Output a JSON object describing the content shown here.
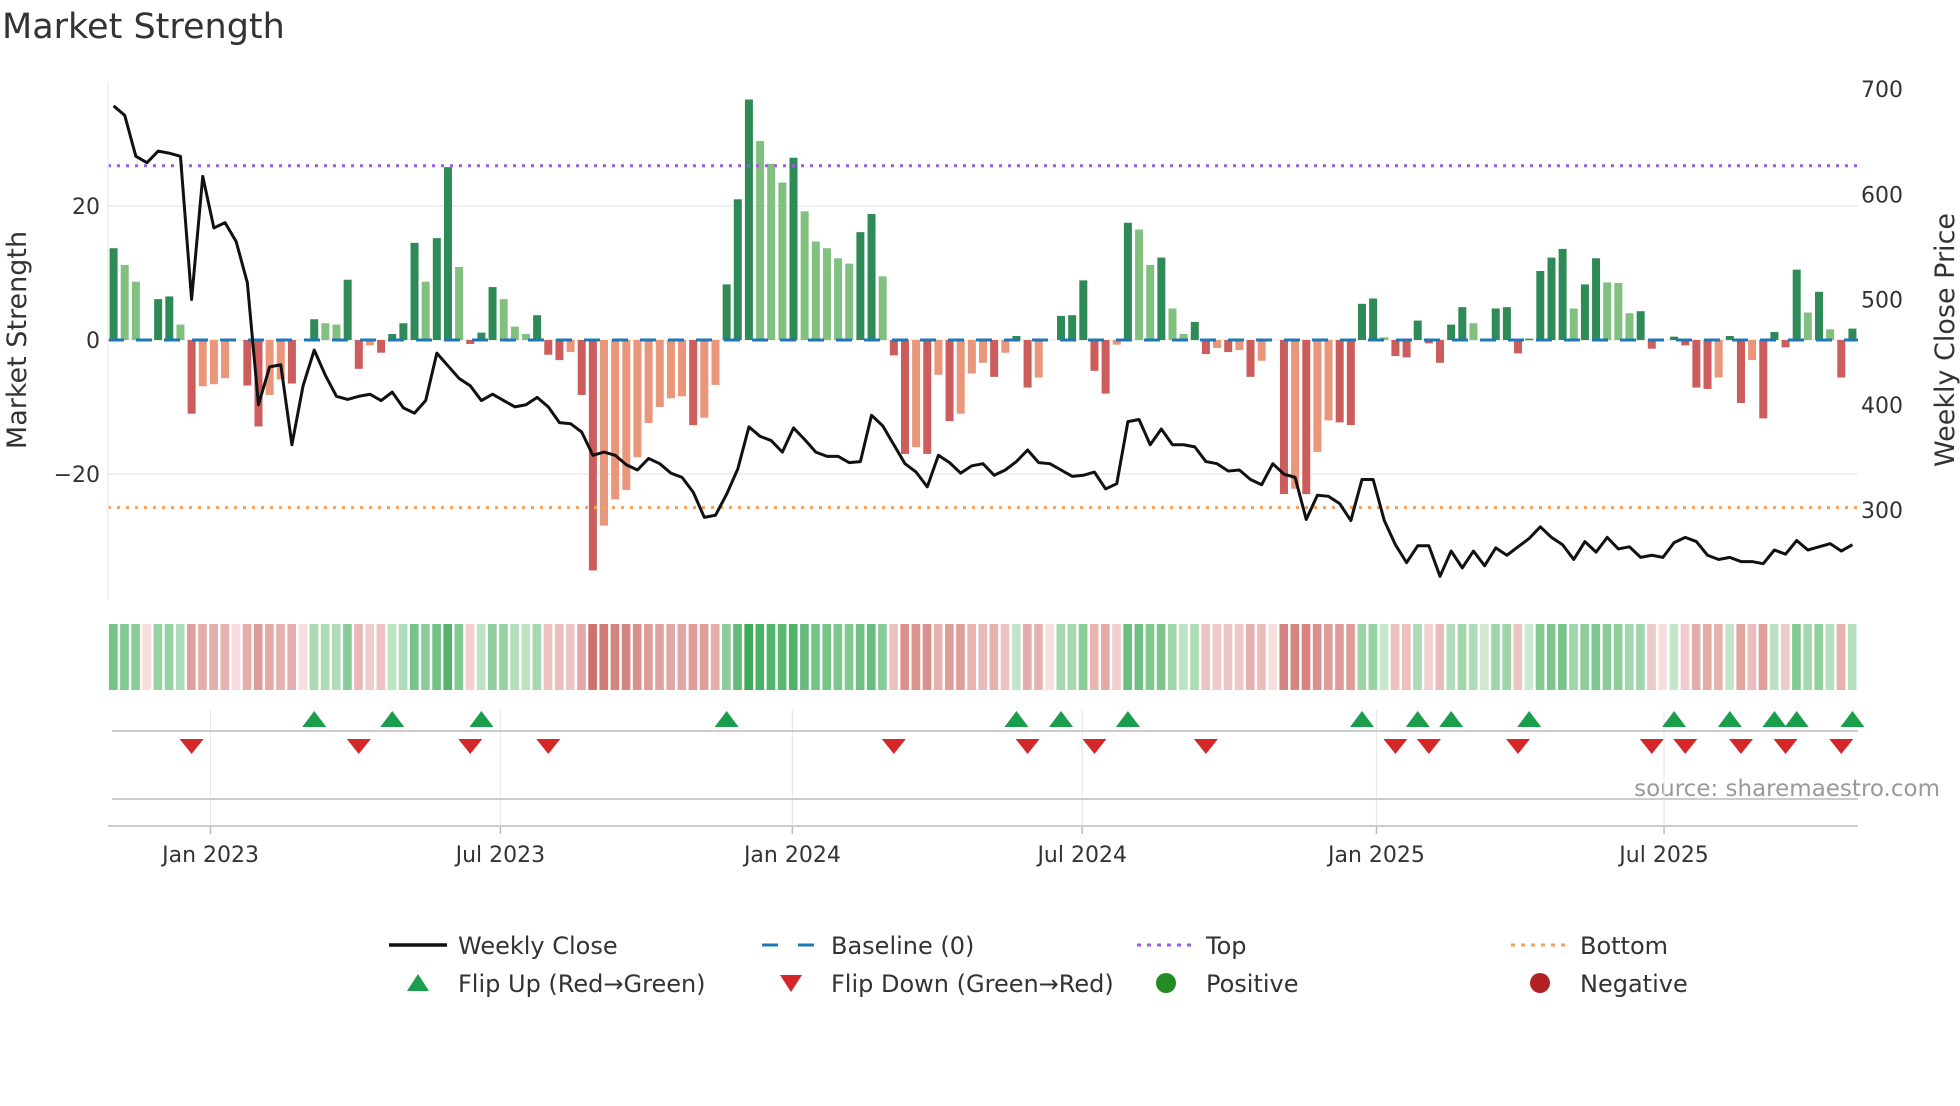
{
  "title": "Market Strength",
  "source": "source: sharemaestro.com",
  "colors": {
    "pos_dark": "#2e8b57",
    "pos_light": "#82c07f",
    "neg_dark": "#cd5c5c",
    "neg_light": "#e9967a",
    "baseline": "#1f77b4",
    "top": "#9b5de5",
    "bottom": "#f4a261",
    "close": "#111111",
    "flip_up": "#1a9e4b",
    "flip_down": "#d62728",
    "positive": "#228b22",
    "negative": "#b22222"
  },
  "chart_data": {
    "type": "bar",
    "title": "Market Strength",
    "ylabel": "Market Strength",
    "y2label": "Weekly Close Price",
    "ylim": [
      -38,
      38
    ],
    "y2lim": [
      190,
      700
    ],
    "yticks": [
      {
        "v": 20,
        "label": "20"
      },
      {
        "v": 0,
        "label": "0"
      },
      {
        "v": -20,
        "label": "−20"
      }
    ],
    "y2ticks": [
      {
        "v": 700,
        "label": "700"
      },
      {
        "v": 600,
        "label": "600"
      },
      {
        "v": 500,
        "label": "500"
      },
      {
        "v": 400,
        "label": "400"
      },
      {
        "v": 300,
        "label": "300"
      }
    ],
    "top_level": 26,
    "bottom_level": -25,
    "baseline": 0,
    "xticks": [
      {
        "week": 8.7,
        "label": "Jan 2023"
      },
      {
        "week": 34.7,
        "label": "Jul 2023"
      },
      {
        "week": 60.9,
        "label": "Jan 2024"
      },
      {
        "week": 86.9,
        "label": "Jul 2024"
      },
      {
        "week": 113.3,
        "label": "Jan 2025"
      },
      {
        "week": 139.1,
        "label": "Jul 2025"
      }
    ],
    "strength": [
      13.7,
      11.2,
      8.7,
      0,
      6.1,
      6.5,
      2.3,
      -11,
      -6.9,
      -6.6,
      -5.7,
      0,
      -6.8,
      -12.9,
      -8.2,
      -5.9,
      -6.5,
      0,
      3.1,
      2.5,
      2.3,
      9,
      -4.3,
      -0.8,
      -1.9,
      0.9,
      2.5,
      14.5,
      8.7,
      15.2,
      25.8,
      10.9,
      -0.6,
      1.1,
      7.9,
      6.1,
      2,
      0.9,
      3.7,
      -2.2,
      -3,
      -1.8,
      -8.2,
      -34.4,
      -27.7,
      -23.8,
      -22.4,
      -17.5,
      -12.4,
      -10,
      -8.7,
      -8.4,
      -12.7,
      -11.6,
      -6.7,
      8.3,
      21,
      35.9,
      29.7,
      26.3,
      23.5,
      27.2,
      19.2,
      14.7,
      13.7,
      12.2,
      11.4,
      16.1,
      18.8,
      9.5,
      -2.3,
      -17,
      -16,
      -17,
      -5.2,
      -12.1,
      -11,
      -5,
      -3.4,
      -5.5,
      -1.9,
      0.6,
      -7.1,
      -5.6,
      0,
      3.6,
      3.7,
      8.9,
      -4.6,
      -8,
      -0.7,
      17.5,
      16.5,
      11.2,
      12.3,
      4.7,
      0.9,
      2.7,
      -2.1,
      -1.2,
      -1.8,
      -1.5,
      -5.5,
      -3.1,
      0,
      -23,
      -22.2,
      -23,
      -16.7,
      -12,
      -12.3,
      -12.7,
      5.4,
      6.2,
      0.4,
      -2.4,
      -2.6,
      2.9,
      -0.5,
      -3.4,
      2.3,
      4.9,
      2.5,
      0.1,
      4.7,
      4.9,
      -2,
      0.2,
      10.3,
      12.3,
      13.6,
      4.7,
      8.3,
      12.2,
      8.6,
      8.5,
      4,
      4.3,
      -1.3,
      0,
      0.5,
      -0.8,
      -7.1,
      -7.3,
      -5.6,
      0.6,
      -9.4,
      -3,
      -11.7,
      1.2,
      -1.1,
      10.5,
      4.1,
      7.2,
      1.6,
      -5.6,
      1.7
    ],
    "weekly_close": [
      684,
      675,
      636,
      630,
      641,
      639,
      636,
      500,
      617,
      568,
      573,
      555,
      516,
      400,
      436,
      438,
      362,
      418,
      452,
      428,
      408,
      405,
      408,
      410,
      404,
      412,
      397,
      392,
      404,
      449,
      437,
      425,
      418,
      404,
      410,
      404,
      398,
      400,
      407,
      398,
      383,
      382,
      374,
      352,
      355,
      352,
      343,
      338,
      349,
      344,
      335,
      331,
      317,
      293,
      295,
      315,
      339,
      379,
      370,
      366,
      355,
      378,
      367,
      355,
      351,
      351,
      345,
      346,
      390,
      380,
      362,
      344,
      336,
      322,
      352,
      345,
      335,
      342,
      344,
      333,
      338,
      346,
      357,
      345,
      344,
      338,
      332,
      333,
      336,
      320,
      325,
      384,
      386,
      362,
      377,
      362,
      362,
      360,
      346,
      344,
      337,
      338,
      329,
      324,
      344,
      334,
      331,
      291,
      314,
      313,
      306,
      290,
      329,
      329,
      290,
      267,
      250,
      266,
      266,
      237,
      261,
      245,
      261,
      247,
      264,
      257,
      265,
      273,
      284,
      274,
      267,
      253,
      270,
      260,
      274,
      263,
      265,
      255,
      257,
      255,
      269,
      274,
      270,
      257,
      253,
      255,
      251,
      251,
      249,
      262,
      258,
      271,
      262,
      265,
      268,
      261,
      267
    ],
    "legend": {
      "placement": "bottom",
      "items": [
        {
          "key": "close",
          "label": "Weekly Close",
          "kind": "line"
        },
        {
          "key": "baseline",
          "label": "Baseline (0)",
          "kind": "dash"
        },
        {
          "key": "top",
          "label": "Top",
          "kind": "dot"
        },
        {
          "key": "bottom",
          "label": "Bottom",
          "kind": "dot"
        },
        {
          "key": "flip_up",
          "label": "Flip Up (Red→Green)",
          "kind": "up"
        },
        {
          "key": "flip_down",
          "label": "Flip Down (Green→Red)",
          "kind": "down"
        },
        {
          "key": "positive",
          "label": "Positive",
          "kind": "circle"
        },
        {
          "key": "negative",
          "label": "Negative",
          "kind": "circle"
        }
      ]
    }
  }
}
